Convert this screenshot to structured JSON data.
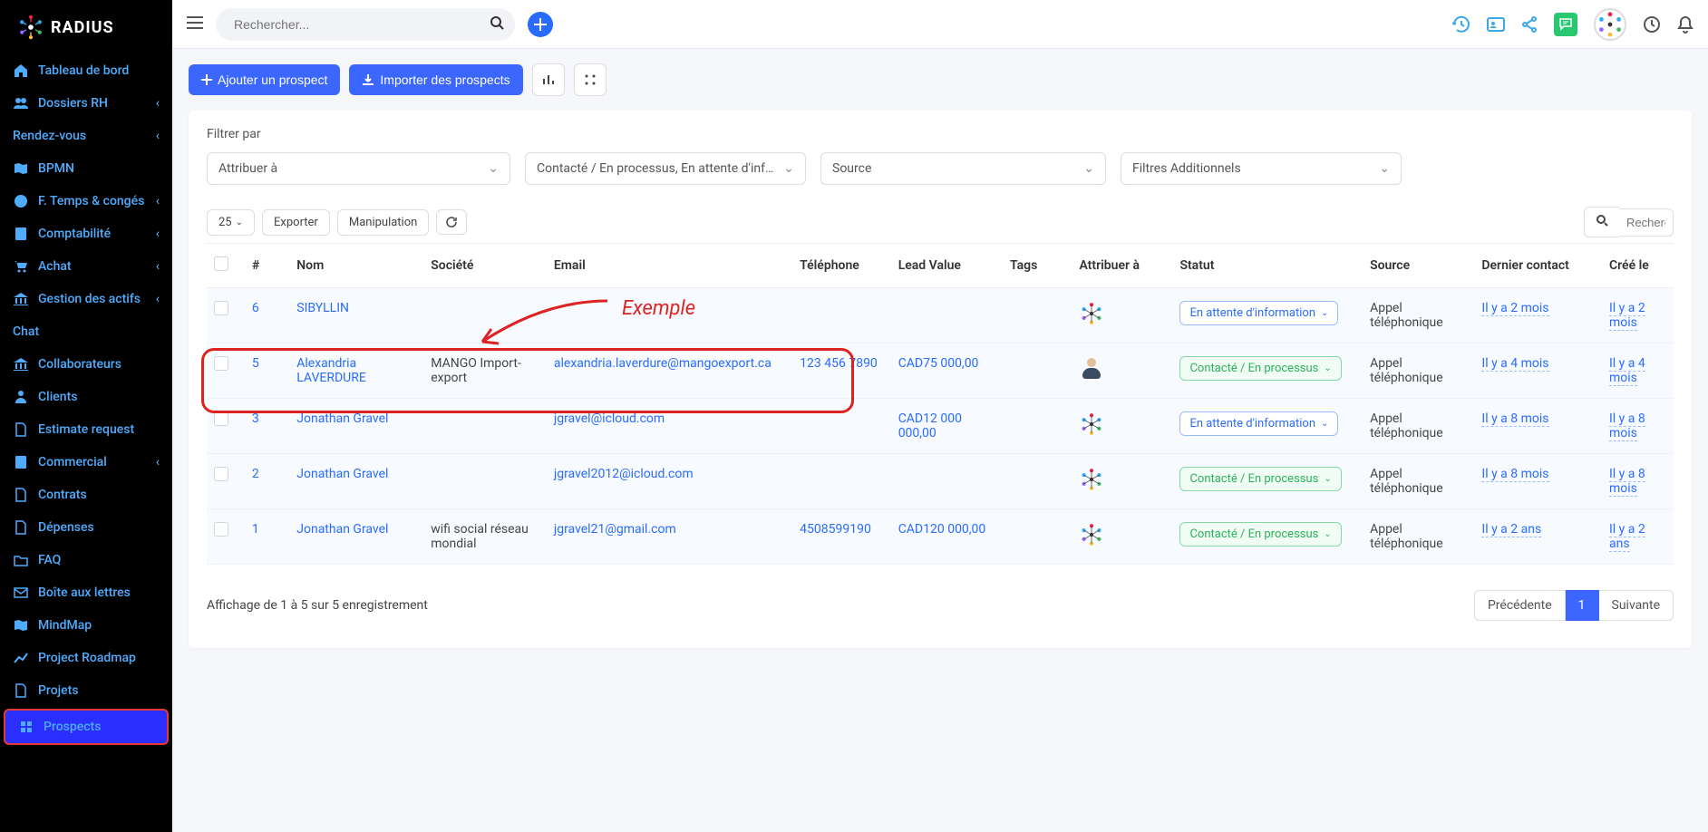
{
  "app": {
    "name": "RADIUS"
  },
  "search": {
    "placeholder": "Rechercher..."
  },
  "sidebar": {
    "items": [
      {
        "icon": "home",
        "label": "Tableau de bord",
        "chev": false
      },
      {
        "icon": "users",
        "label": "Dossiers RH",
        "chev": true
      },
      {
        "icon": "",
        "label": "Rendez-vous",
        "chev": true,
        "noicon": true
      },
      {
        "icon": "map",
        "label": "BPMN",
        "chev": false
      },
      {
        "icon": "userclock",
        "label": "F. Temps & congés",
        "chev": true
      },
      {
        "icon": "book",
        "label": "Comptabilité",
        "chev": true
      },
      {
        "icon": "cart",
        "label": "Achat",
        "chev": true
      },
      {
        "icon": "bank",
        "label": "Gestion des actifs",
        "chev": true
      },
      {
        "icon": "",
        "label": "Chat",
        "chev": false,
        "noicon": true
      },
      {
        "icon": "bank",
        "label": "Collaborateurs",
        "chev": false
      },
      {
        "icon": "person",
        "label": "Clients",
        "chev": false
      },
      {
        "icon": "doc",
        "label": "Estimate request",
        "chev": false
      },
      {
        "icon": "book",
        "label": "Commercial",
        "chev": true
      },
      {
        "icon": "doc",
        "label": "Contrats",
        "chev": false
      },
      {
        "icon": "doc",
        "label": "Dépenses",
        "chev": false
      },
      {
        "icon": "folder",
        "label": "FAQ",
        "chev": false
      },
      {
        "icon": "mail",
        "label": "Boîte aux lettres",
        "chev": false
      },
      {
        "icon": "map",
        "label": "MindMap",
        "chev": false
      },
      {
        "icon": "chart",
        "label": "Project Roadmap",
        "chev": false
      },
      {
        "icon": "doc",
        "label": "Projets",
        "chev": false
      },
      {
        "icon": "app",
        "label": "Prospects",
        "chev": false,
        "active": true
      }
    ]
  },
  "toolbar": {
    "add_prospect": "Ajouter un prospect",
    "import_prospects": "Importer des prospects"
  },
  "filters": {
    "label": "Filtrer par",
    "assign": "Attribuer à",
    "status_value": "Contacté / En processus, En attente d'information...",
    "source": "Source",
    "additional": "Filtres Additionnels"
  },
  "tabletools": {
    "pagesize": "25",
    "export": "Exporter",
    "manipulation": "Manipulation",
    "search_placeholder": "Recherc"
  },
  "columns": {
    "num": "#",
    "nom": "Nom",
    "societe": "Société",
    "email": "Email",
    "tel": "Téléphone",
    "leadv": "Lead Value",
    "tags": "Tags",
    "attr": "Attribuer à",
    "statut": "Statut",
    "source": "Source",
    "dernier": "Dernier contact",
    "cree": "Créé le"
  },
  "rows": [
    {
      "num": "6",
      "nom": "SIBYLLIN",
      "soc": "",
      "email": "",
      "tel": "",
      "leadv": "",
      "assignee": "logo",
      "statut": "wait",
      "statut_label": "En attente d'information",
      "src": "Appel téléphonique",
      "dernier": "Il y a 2 mois",
      "cree": "Il y a 2 mois"
    },
    {
      "num": "5",
      "nom": "Alexandria LAVERDURE",
      "soc": "MANGO Import-export",
      "email": "alexandria.laverdure@mangoexport.ca",
      "tel": "123 456 7890",
      "leadv": "CAD75 000,00",
      "assignee": "person",
      "statut": "proc",
      "statut_label": "Contacté / En processus",
      "src": "Appel téléphonique",
      "dernier": "Il y a 4 mois",
      "cree": "Il y a 4 mois"
    },
    {
      "num": "3",
      "nom": "Jonathan Gravel",
      "soc": "",
      "email": "jgravel@icloud.com",
      "tel": "",
      "leadv": "CAD12 000 000,00",
      "assignee": "logo",
      "statut": "wait",
      "statut_label": "En attente d'information",
      "src": "Appel téléphonique",
      "dernier": "Il y a 8 mois",
      "cree": "Il y a 8 mois"
    },
    {
      "num": "2",
      "nom": "Jonathan Gravel",
      "soc": "",
      "email": "jgravel2012@icloud.com",
      "tel": "",
      "leadv": "",
      "assignee": "logo",
      "statut": "proc",
      "statut_label": "Contacté / En processus",
      "src": "Appel téléphonique",
      "dernier": "Il y a 8 mois",
      "cree": "Il y a 8 mois"
    },
    {
      "num": "1",
      "nom": "Jonathan Gravel",
      "soc": "wifi social réseau mondial",
      "email": "jgravel21@gmail.com",
      "tel": "4508599190",
      "leadv": "CAD120 000,00",
      "assignee": "logo",
      "statut": "proc",
      "statut_label": "Contacté / En processus",
      "src": "Appel téléphonique",
      "dernier": "Il y a 2 ans",
      "cree": "Il y a 2 ans"
    }
  ],
  "paging": {
    "summary": "Affichage de 1 à 5 sur 5 enregistrement",
    "prev": "Précédente",
    "page": "1",
    "next": "Suivante"
  },
  "annotation": {
    "label": "Exemple"
  }
}
